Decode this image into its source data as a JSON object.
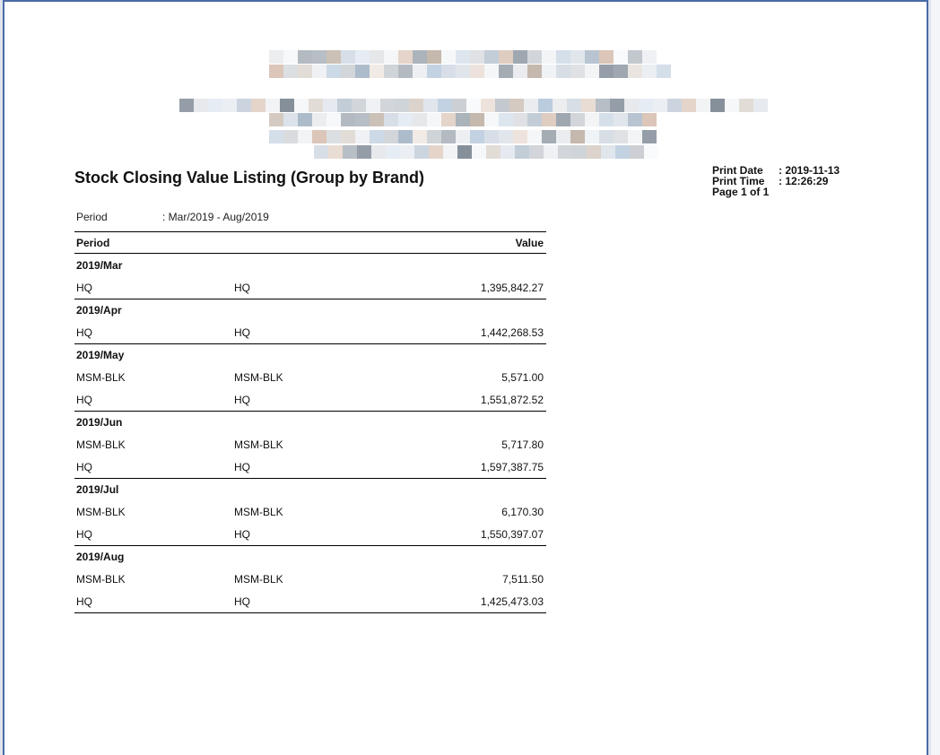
{
  "report": {
    "title": "Stock Closing Value Listing (Group by Brand)",
    "print_date_label": "Print Date",
    "print_date_value": ": 2019-11-13",
    "print_time_label": "Print Time",
    "print_time_value": ": 12:26:29",
    "page_label": "Page 1 of 1",
    "period_label": "Period",
    "period_value": ": Mar/2019 - Aug/2019",
    "columns": {
      "period": "Period",
      "value": "Value"
    },
    "groups": [
      {
        "period": "2019/Mar",
        "rows": [
          {
            "code": "HQ",
            "desc": "HQ",
            "value": "1,395,842.27"
          }
        ]
      },
      {
        "period": "2019/Apr",
        "rows": [
          {
            "code": "HQ",
            "desc": "HQ",
            "value": "1,442,268.53"
          }
        ]
      },
      {
        "period": "2019/May",
        "rows": [
          {
            "code": "MSM-BLK",
            "desc": "MSM-BLK",
            "value": "5,571.00"
          },
          {
            "code": "HQ",
            "desc": "HQ",
            "value": "1,551,872.52"
          }
        ]
      },
      {
        "period": "2019/Jun",
        "rows": [
          {
            "code": "MSM-BLK",
            "desc": "MSM-BLK",
            "value": "5,717.80"
          },
          {
            "code": "HQ",
            "desc": "HQ",
            "value": "1,597,387.75"
          }
        ]
      },
      {
        "period": "2019/Jul",
        "rows": [
          {
            "code": "MSM-BLK",
            "desc": "MSM-BLK",
            "value": "6,170.30"
          },
          {
            "code": "HQ",
            "desc": "HQ",
            "value": "1,550,397.07"
          }
        ]
      },
      {
        "period": "2019/Aug",
        "rows": [
          {
            "code": "MSM-BLK",
            "desc": "MSM-BLK",
            "value": "7,511.50"
          },
          {
            "code": "HQ",
            "desc": "HQ",
            "value": "1,425,473.03"
          }
        ]
      }
    ]
  },
  "colors": {
    "page_border": "#4a6aa8",
    "redaction_palette": [
      "#c9ccd1",
      "#9aa3ad",
      "#b7c9dc",
      "#d9c3b5",
      "#e6e8ec",
      "#a9b8c8",
      "#7f8a96",
      "#d5dce6",
      "#eef0f3",
      "#c2b4a8"
    ]
  }
}
